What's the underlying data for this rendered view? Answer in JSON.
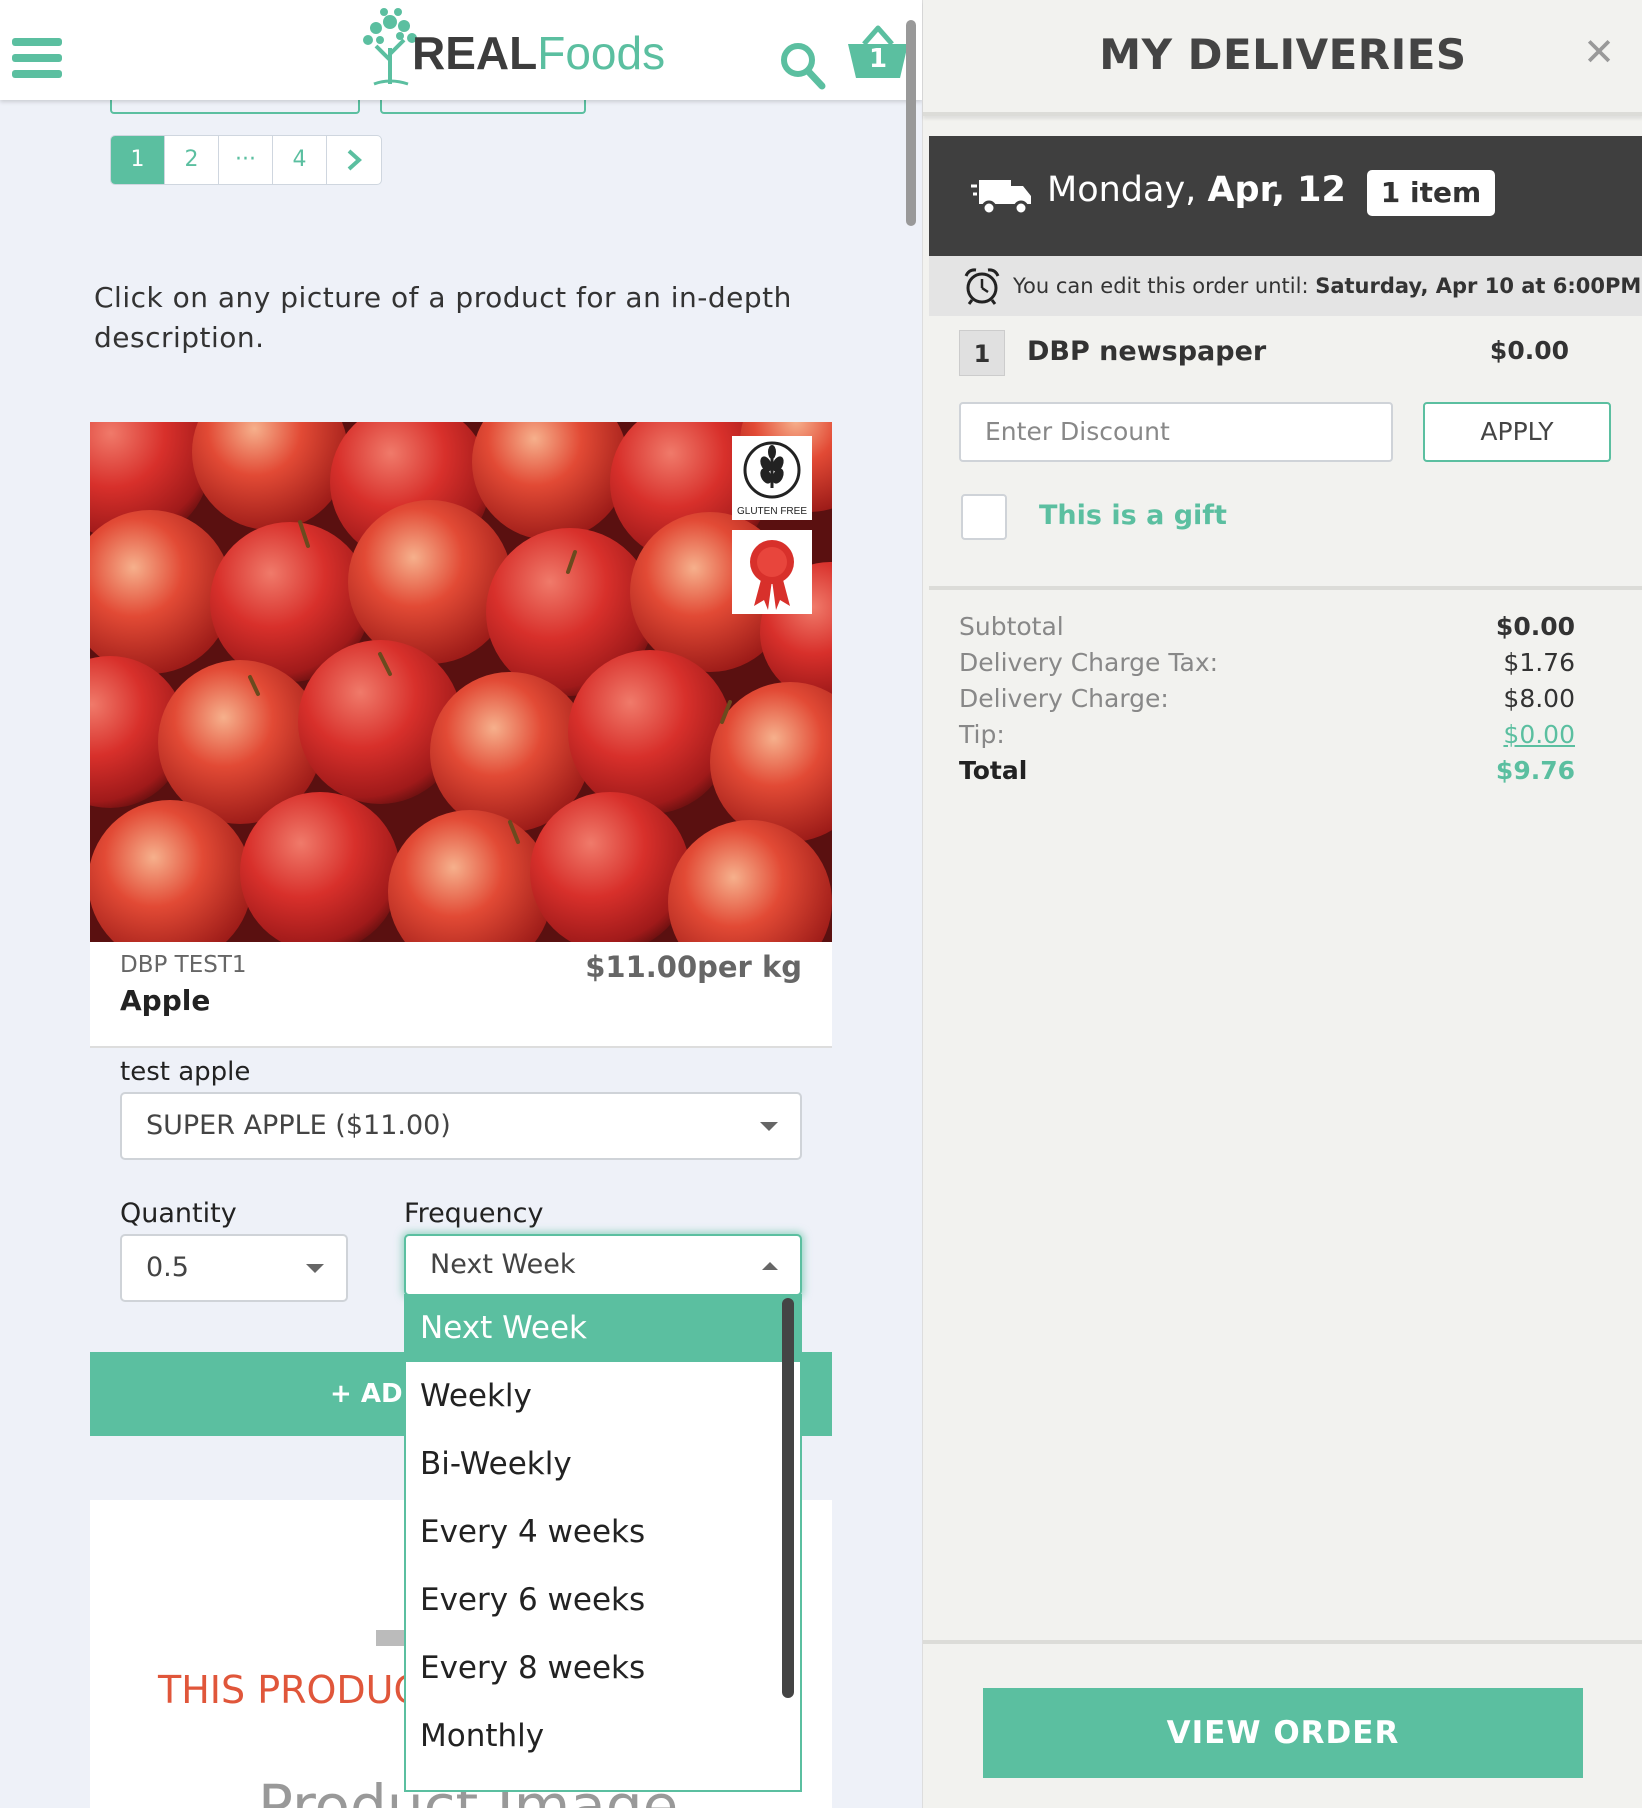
{
  "header": {
    "logo_real": "REAL",
    "logo_foods": "Foods",
    "cart_count": "1",
    "icons": {
      "menu": "hamburger-icon",
      "search": "search-icon",
      "cart": "basket-icon"
    }
  },
  "pagination": {
    "pages": [
      "1",
      "2",
      "···",
      "4"
    ],
    "active": "1",
    "next_icon": "chevron-right-icon"
  },
  "intro_text": "Click on any picture of a product for an in-depth description.",
  "product": {
    "vendor": "DBP TEST1",
    "name": "Apple",
    "price": "$11.00per kg",
    "badges": [
      {
        "icon": "gluten-free-icon",
        "label": "GLUTEN FREE"
      },
      {
        "icon": "award-ribbon-icon"
      }
    ],
    "option_label": "test apple",
    "option_value": "SUPER APPLE ($11.00)",
    "quantity_label": "Quantity",
    "quantity_value": "0.5",
    "frequency_label": "Frequency",
    "frequency_value": "Next Week",
    "frequency_options": [
      "Next Week",
      "Weekly",
      "Bi-Weekly",
      "Every 4 weeks",
      "Every 6 weeks",
      "Every 8 weeks",
      "Monthly"
    ],
    "add_button": "+ ADD"
  },
  "next_card": {
    "unavailable_text": "THIS PRODUC",
    "image_placeholder": "Product Image"
  },
  "panel": {
    "title": "MY DELIVERIES",
    "close_icon": "close-icon",
    "delivery": {
      "day": "Monday,",
      "date": "Apr, 12",
      "item_count": "1 item",
      "truck_icon": "truck-icon"
    },
    "edit_notice": {
      "prefix": "You can edit this order until:",
      "deadline": "Saturday, Apr 10 at 6:00PM",
      "icon": "alarm-clock-icon"
    },
    "line_item": {
      "qty": "1",
      "name": "DBP newspaper",
      "price": "$0.00"
    },
    "discount_placeholder": "Enter Discount",
    "apply_label": "APPLY",
    "gift_label": "This is a gift",
    "totals": {
      "subtotal_label": "Subtotal",
      "subtotal": "$0.00",
      "tax_label": "Delivery Charge Tax:",
      "tax": "$1.76",
      "delivery_label": "Delivery Charge:",
      "delivery": "$8.00",
      "tip_label": "Tip:",
      "tip": "$0.00",
      "total_label": "Total",
      "total": "$9.76"
    },
    "view_order": "VIEW ORDER"
  },
  "colors": {
    "accent": "#5bbfa0",
    "dark_bar": "#3f3f3f",
    "warning": "#e0563a"
  }
}
